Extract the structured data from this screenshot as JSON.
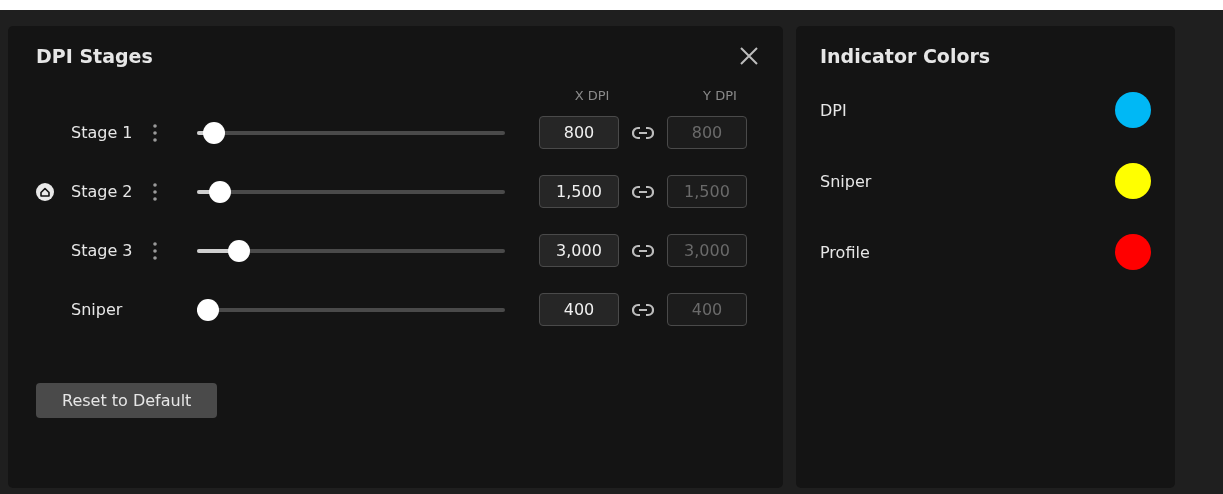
{
  "dpi_panel": {
    "title": "DPI Stages",
    "x_header": "X DPI",
    "y_header": "Y DPI",
    "stages": [
      {
        "kind": "stage",
        "label": "Stage 1",
        "selected": false,
        "level": 0.03,
        "x_dpi": "800",
        "y_dpi": "800",
        "y_disabled": true
      },
      {
        "kind": "stage",
        "label": "Stage 2",
        "selected": true,
        "level": 0.05,
        "x_dpi": "1,500",
        "y_dpi": "1,500",
        "y_disabled": true
      },
      {
        "kind": "stage",
        "label": "Stage 3",
        "selected": false,
        "level": 0.11,
        "x_dpi": "3,000",
        "y_dpi": "3,000",
        "y_disabled": true
      },
      {
        "kind": "sniper",
        "label": "Sniper",
        "selected": false,
        "level": 0.01,
        "x_dpi": "400",
        "y_dpi": "400",
        "y_disabled": true
      }
    ],
    "reset_button": "Reset to Default"
  },
  "indicator_panel": {
    "title": "Indicator Colors",
    "items": [
      {
        "label": "DPI",
        "color": "#00b8f5"
      },
      {
        "label": "Sniper",
        "color": "#ffff00"
      },
      {
        "label": "Profile",
        "color": "#ff0000"
      }
    ]
  }
}
